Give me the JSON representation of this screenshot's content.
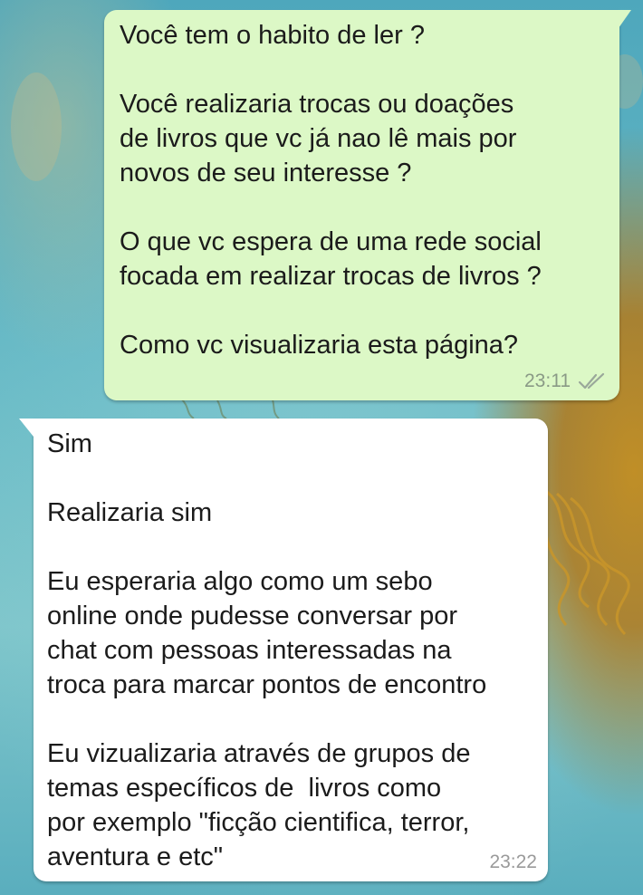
{
  "colors": {
    "outgoing_bubble": "#dcf8c6",
    "incoming_bubble": "#ffffff",
    "wallpaper_teal": "#5fb0bf",
    "jellyfish_amber": "#c48c1e",
    "timestamp_gray": "#8a9a86"
  },
  "messages": {
    "outgoing": {
      "lines": [
        "Você tem o habito de ler ?",
        "",
        "Você realizaria trocas ou doações",
        "de livros que vc já nao lê mais por",
        "novos de seu interesse ?",
        "",
        "O que vc espera de uma rede social",
        "focada em realizar trocas de livros ?",
        "",
        "Como vc visualizaria esta página?"
      ],
      "time": "23:11",
      "status_icon": "double-check-read-icon"
    },
    "incoming": {
      "lines": [
        "Sim",
        "",
        "Realizaria sim",
        "",
        "Eu esperaria algo como um sebo",
        "online onde pudesse conversar por",
        "chat com pessoas interessadas na",
        "troca para marcar pontos de encontro",
        "",
        "Eu vizualizaria através de grupos de",
        "temas específicos de  livros como",
        "por exemplo \"ficção cientifica, terror,",
        "aventura e etc\""
      ],
      "time": "23:22"
    }
  }
}
